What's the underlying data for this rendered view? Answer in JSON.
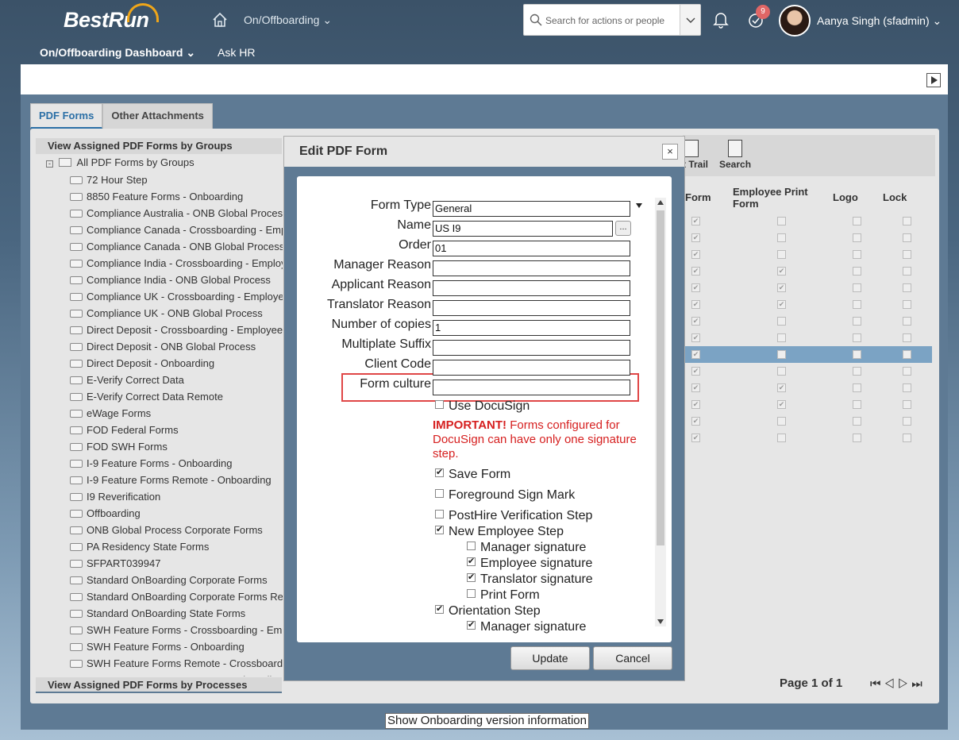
{
  "header": {
    "logo_text": "BestRun",
    "module": "On/Offboarding",
    "search_placeholder": "Search for actions or people",
    "notification_count": "9",
    "user_name": "Aanya Singh (sfadmin)",
    "subnav": [
      "On/Offboarding Dashboard",
      "Ask HR"
    ],
    "accent_color": "#f0a619"
  },
  "tabs": [
    "PDF Forms",
    "Other Attachments"
  ],
  "tree": {
    "header": "View Assigned PDF Forms by Groups",
    "root": "All PDF Forms by Groups",
    "items": [
      "72 Hour Step",
      "8850 Feature Forms - Onboarding",
      "Compliance Australia - ONB Global Process",
      "Compliance Canada - Crossboarding - Employee",
      "Compliance Canada - ONB Global Process",
      "Compliance India - Crossboarding - Employee",
      "Compliance India - ONB Global Process",
      "Compliance UK - Crossboarding - Employee",
      "Compliance UK - ONB Global Process",
      "Direct Deposit - Crossboarding - Employee",
      "Direct Deposit - ONB Global Process",
      "Direct Deposit - Onboarding",
      "E-Verify Correct Data",
      "E-Verify Correct Data Remote",
      "eWage Forms",
      "FOD Federal Forms",
      "FOD SWH Forms",
      "I-9 Feature Forms - Onboarding",
      "I-9 Feature Forms Remote - Onboarding",
      "I9 Reverification",
      "Offboarding",
      "ONB Global Process Corporate Forms",
      "PA Residency State Forms",
      "SFPART039947",
      "Standard OnBoarding Corporate Forms",
      "Standard OnBoarding Corporate Forms Remote",
      "Standard OnBoarding State Forms",
      "SWH Feature Forms - Crossboarding - Employee",
      "SWH Feature Forms - Onboarding",
      "SWH Feature Forms Remote - Crossboarding",
      "SWH Feature Forms Remote - Onboarding"
    ],
    "footer": "View Assigned PDF Forms by Processes"
  },
  "right_table": {
    "toolbar": [
      "t Trail",
      "Search"
    ],
    "columns": [
      "Form",
      "Employee Print Form",
      "Logo",
      "Lock"
    ],
    "rows": [
      [
        true,
        false,
        false,
        false
      ],
      [
        true,
        false,
        false,
        false
      ],
      [
        true,
        false,
        false,
        false
      ],
      [
        true,
        true,
        false,
        false
      ],
      [
        true,
        true,
        false,
        false
      ],
      [
        true,
        true,
        false,
        false
      ],
      [
        true,
        false,
        false,
        false
      ],
      [
        true,
        false,
        false,
        false
      ],
      [
        true,
        false,
        false,
        false
      ],
      [
        true,
        false,
        false,
        false
      ],
      [
        true,
        true,
        false,
        false
      ],
      [
        true,
        true,
        false,
        false
      ],
      [
        true,
        false,
        false,
        false
      ],
      [
        true,
        false,
        false,
        false
      ]
    ],
    "selected_row": 8,
    "pager": "Page 1 of 1"
  },
  "version_link": "Show Onboarding version information",
  "dialog": {
    "title": "Edit PDF Form",
    "close": "×",
    "fields": [
      {
        "label": "Form Type",
        "value": "General",
        "kind": "select"
      },
      {
        "label": "Name",
        "value": "US I9",
        "kind": "lookup"
      },
      {
        "label": "Order",
        "value": "01",
        "kind": "text"
      },
      {
        "label": "Manager Reason",
        "value": "",
        "kind": "text"
      },
      {
        "label": "Applicant Reason",
        "value": "",
        "kind": "text"
      },
      {
        "label": "Translator Reason",
        "value": "",
        "kind": "text"
      },
      {
        "label": "Number of copies",
        "value": "1",
        "kind": "text"
      },
      {
        "label": "Multiplate Suffix",
        "value": "",
        "kind": "text"
      },
      {
        "label": "Client Code",
        "value": "",
        "kind": "text"
      },
      {
        "label": "Form culture",
        "value": "",
        "kind": "text"
      }
    ],
    "lookup_button": "...",
    "use_docusign": {
      "label": "Use DocuSign",
      "checked": false
    },
    "important_prefix": "IMPORTANT!",
    "important_text": " Forms configured for DocuSign can have only one signature step.",
    "checks": [
      {
        "label": "Save Form",
        "checked": true,
        "indent": 0
      },
      {
        "label": "Foreground Sign Mark",
        "checked": false,
        "indent": 0
      },
      {
        "label": "PostHire Verification Step",
        "checked": false,
        "indent": 0
      },
      {
        "label": "New Employee Step",
        "checked": true,
        "indent": 0
      },
      {
        "label": "Manager signature",
        "checked": false,
        "indent": 1
      },
      {
        "label": "Employee signature",
        "checked": true,
        "indent": 1
      },
      {
        "label": "Translator signature",
        "checked": true,
        "indent": 1
      },
      {
        "label": "Print Form",
        "checked": false,
        "indent": 1
      },
      {
        "label": "Orientation Step",
        "checked": true,
        "indent": 0
      },
      {
        "label": "Manager signature",
        "checked": true,
        "indent": 1
      }
    ],
    "update_button": "Update",
    "cancel_button": "Cancel",
    "highlight_color": "#e04646"
  }
}
